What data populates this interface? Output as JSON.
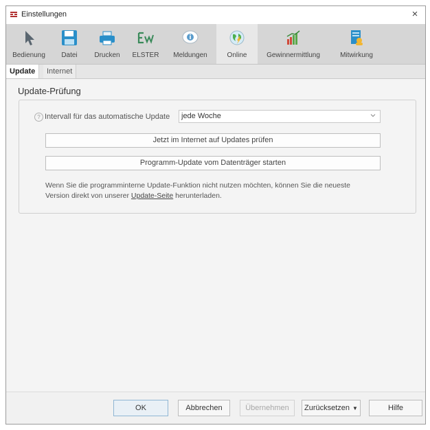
{
  "window": {
    "title": "Einstellungen",
    "close_label": "×"
  },
  "toolbar": {
    "items": [
      {
        "label": "Bedienung",
        "icon": "cursor-arrow-icon"
      },
      {
        "label": "Datei",
        "icon": "floppy-disk-icon"
      },
      {
        "label": "Drucken",
        "icon": "printer-icon"
      },
      {
        "label": "ELSTER",
        "icon": "elster-logo-icon"
      },
      {
        "label": "Meldungen",
        "icon": "info-bubble-icon"
      },
      {
        "label": "Online",
        "icon": "globe-icon"
      },
      {
        "label": "Gewinnermittlung",
        "icon": "bar-chart-icon"
      },
      {
        "label": "Mitwirkung",
        "icon": "document-person-icon"
      }
    ],
    "active": "Online"
  },
  "subtabs": {
    "items": [
      "Update",
      "Internet"
    ],
    "active": "Update"
  },
  "update": {
    "section_title": "Update-Prüfung",
    "interval_label": "Intervall für das automatische Update",
    "interval_value": "jede Woche",
    "check_button": "Jetzt im Internet auf Updates prüfen",
    "media_button": "Programm-Update vom Datenträger starten",
    "info_line1": "Wenn Sie die programminterne Update-Funktion nicht nutzen möchten, können Sie die neueste",
    "info_line2_before": "Version direkt von unserer ",
    "info_link": "Update-Seite",
    "info_line2_after": " herunterladen."
  },
  "footer": {
    "ok": "OK",
    "cancel": "Abbrechen",
    "apply": "Übernehmen",
    "reset": "Zurücksetzen",
    "help": "Hilfe"
  },
  "colors": {
    "accent": "#8fb5d3",
    "toolbar_bg": "#d6d6d6",
    "content_bg": "#f4f4f4"
  }
}
